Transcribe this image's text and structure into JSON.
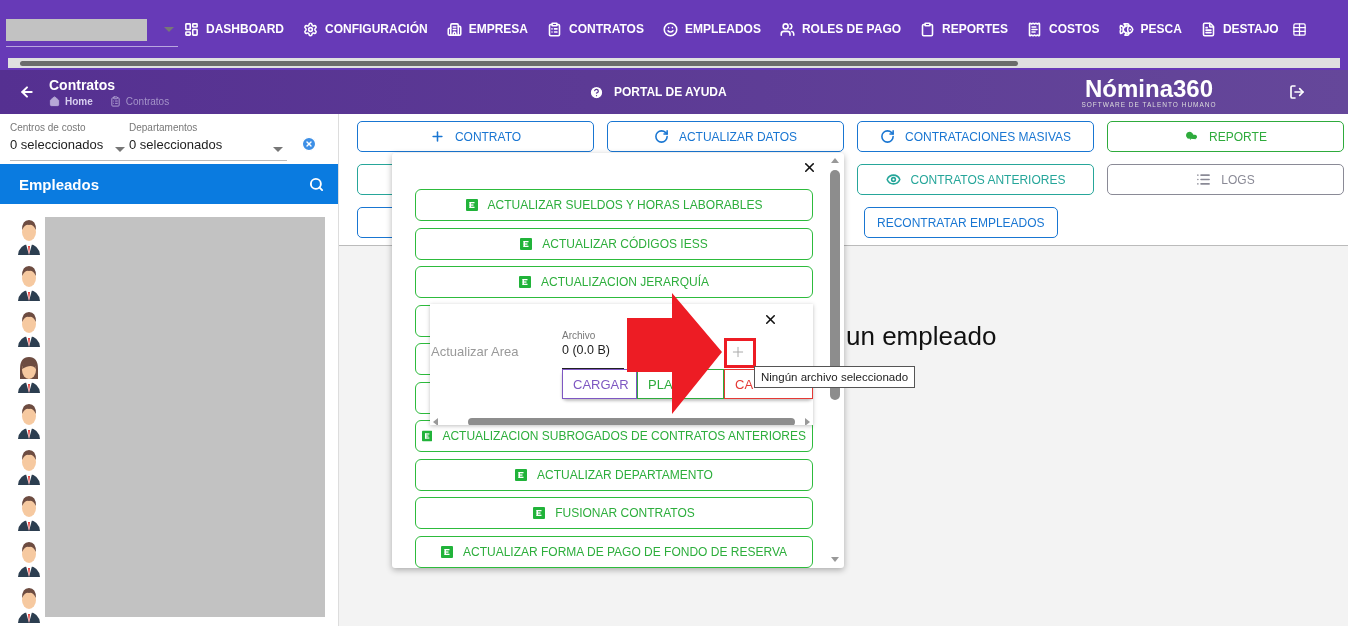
{
  "nav": {
    "items": [
      {
        "label": "DASHBOARD"
      },
      {
        "label": "CONFIGURACIÓN"
      },
      {
        "label": "EMPRESA"
      },
      {
        "label": "CONTRATOS"
      },
      {
        "label": "EMPLEADOS"
      },
      {
        "label": "ROLES DE PAGO"
      },
      {
        "label": "REPORTES"
      },
      {
        "label": "COSTOS"
      },
      {
        "label": "PESCA"
      },
      {
        "label": "DESTAJO"
      }
    ]
  },
  "header": {
    "title": "Contratos",
    "breadcrumb": [
      "Home",
      "Contratos"
    ],
    "help": "PORTAL DE AYUDA",
    "logo": "Nómina360",
    "logo_tagline": "SOFTWARE DE TALENTO HUMANO"
  },
  "filters": [
    {
      "label": "Centros de costo",
      "value": "0 seleccionados"
    },
    {
      "label": "Departamentos",
      "value": "0 seleccionados"
    }
  ],
  "employees": {
    "title": "Empleados",
    "list": [
      {
        "kind": "man"
      },
      {
        "kind": "man"
      },
      {
        "kind": "man"
      },
      {
        "kind": "woman"
      },
      {
        "kind": "man"
      },
      {
        "kind": "man"
      },
      {
        "kind": "man"
      },
      {
        "kind": "man"
      },
      {
        "kind": "man"
      }
    ]
  },
  "actions": [
    [
      {
        "kind": "labeled",
        "label": "CONTRATO",
        "color": "#1976d2"
      },
      {
        "kind": "labeled",
        "label": "ACTUALIZAR DATOS",
        "color": "#1976d2"
      },
      {
        "kind": "labeled",
        "label": "CONTRATACIONES MASIVAS",
        "color": "#1976d2"
      },
      {
        "kind": "labeled",
        "label": "REPORTE",
        "color": "#2eab3c"
      }
    ],
    [
      {
        "kind": "blank",
        "color": "#26a69a"
      },
      {
        "kind": "labeled",
        "label": "CONTRATOS ANTERIORES",
        "color": "#26a69a"
      },
      {
        "kind": "labeled",
        "label": "LOGS",
        "color": "#8a8a96"
      }
    ],
    [
      {
        "kind": "blank",
        "color": "#1976d2"
      },
      {
        "kind": "labeled",
        "label": "RECONTRATAR EMPLEADOS",
        "color": "#1976d2"
      }
    ]
  ],
  "empty_message": "un empleado",
  "menu": {
    "items": [
      {
        "kind": "labeled",
        "label": "ACTUALIZAR SUELDOS Y HORAS LABORABLES"
      },
      {
        "kind": "labeled",
        "label": "ACTUALIZAR CÓDIGOS IESS"
      },
      {
        "kind": "labeled",
        "label": "ACTUALIZACION JERARQUÍA"
      },
      {
        "kind": "blank"
      },
      {
        "kind": "blank"
      },
      {
        "kind": "blank"
      },
      {
        "kind": "labeled",
        "label": "ACTUALIZACION SUBROGADOS DE CONTRATOS ANTERIORES"
      },
      {
        "kind": "labeled",
        "label": "ACTUALIZAR DEPARTAMENTO"
      },
      {
        "kind": "labeled",
        "label": "FUSIONAR CONTRATOS"
      },
      {
        "kind": "labeled",
        "label": "ACTUALIZAR FORMA DE PAGO DE FONDO DE RESERVA"
      }
    ]
  },
  "upload": {
    "title": "Actualizar Area",
    "field_label": "Archivo",
    "field_value": "0 (0.0 B)",
    "buttons": [
      {
        "label": "CARGAR",
        "color": "#7e57c2"
      },
      {
        "label": "PLA",
        "color": "#2eab3c"
      },
      {
        "label": "CA",
        "color": "#e53935"
      }
    ],
    "tooltip": "Ningún archivo seleccionado"
  }
}
